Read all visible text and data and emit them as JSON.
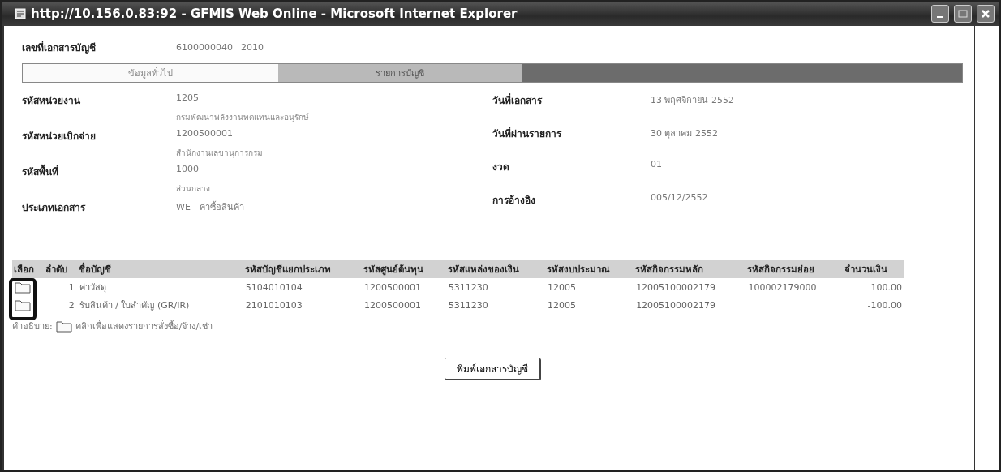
{
  "window": {
    "title": "http://10.156.0.83:92 - GFMIS Web Online - Microsoft Internet Explorer"
  },
  "document": {
    "label": "เลขที่เอกสารบัญชี",
    "number": "6100000040",
    "year": "2010"
  },
  "tabs": [
    {
      "label": "ข้อมูลทั่วไป",
      "selected": true
    },
    {
      "label": "รายการบัญชี",
      "selected": false
    }
  ],
  "left_fields": [
    {
      "label": "รหัสหน่วยงาน",
      "value": "1205",
      "note": "กรมพัฒนาพลังงานทดแทนและอนุรักษ์"
    },
    {
      "label": "รหัสหน่วยเบิกจ่าย",
      "value": "1200500001",
      "note": "สำนักงานเลขานุการกรม"
    },
    {
      "label": "รหัสพื้นที่",
      "value": "1000",
      "note": "ส่วนกลาง"
    },
    {
      "label": "ประเภทเอกสาร",
      "value": "WE - ค่าซื้อสินค้า"
    }
  ],
  "right_fields": [
    {
      "label": "วันที่เอกสาร",
      "value": "13 พฤศจิกายน 2552"
    },
    {
      "label": "วันที่ผ่านรายการ",
      "value": "30 ตุลาคม 2552"
    },
    {
      "label": "งวด",
      "value": "01"
    },
    {
      "label": "การอ้างอิง",
      "value": "005/12/2552"
    }
  ],
  "table": {
    "columns": [
      "เลือก",
      "ลำดับ",
      "ชื่อบัญชี",
      "รหัสบัญชีแยกประเภท",
      "รหัสศูนย์ต้นทุน",
      "รหัสแหล่งของเงิน",
      "รหัสงบประมาณ",
      "รหัสกิจกรรมหลัก",
      "รหัสกิจกรรมย่อย",
      "จำนวนเงิน"
    ],
    "rows": [
      {
        "cells": [
          {
            "kind": "folder"
          },
          "1",
          "ค่าวัสดุ",
          "5104010104",
          "1200500001",
          "5311230",
          "12005",
          "12005100002179",
          "100002179000",
          "100.00"
        ]
      },
      {
        "cells": [
          {
            "kind": "folder"
          },
          "2",
          "รับสินค้า / ใบสำคัญ (GR/IR)",
          "2101010103",
          "1200500001",
          "5311230",
          "12005",
          "12005100002179",
          null,
          "-100.00"
        ]
      }
    ]
  },
  "legend": {
    "label": "คำอธิบาย:",
    "text": "คลิกเพื่อแสดงรายการสั่งซื้อ/จ้าง/เช่า"
  },
  "buttons": [
    "พิมพ์เอกสารบัญชี"
  ]
}
